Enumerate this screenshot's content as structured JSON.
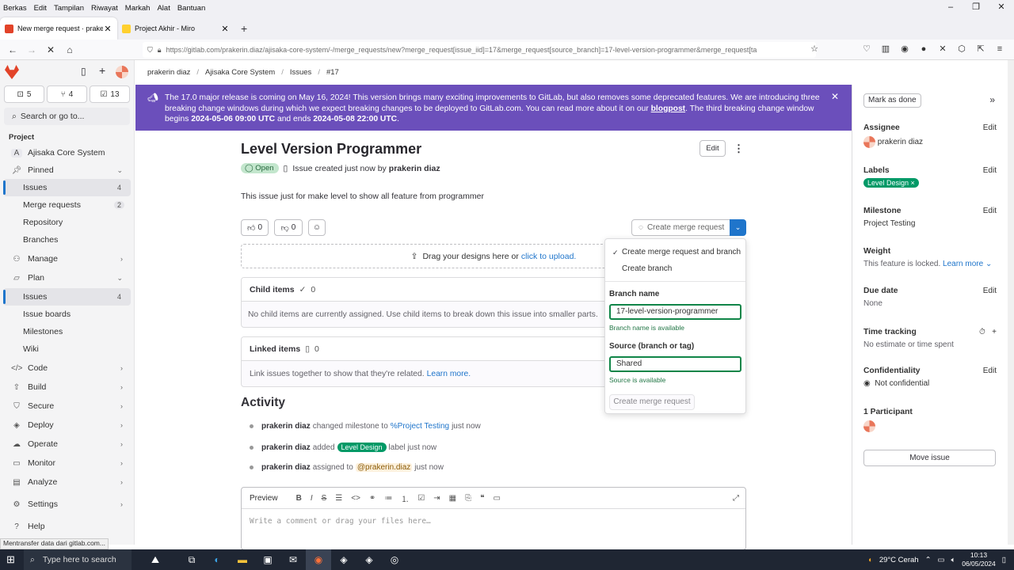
{
  "browser": {
    "menu": [
      "Berkas",
      "Edit",
      "Tampilan",
      "Riwayat",
      "Markah",
      "Alat",
      "Bantuan"
    ],
    "tabs": [
      {
        "title": "New merge request · prakerin d",
        "color": "#e24329"
      },
      {
        "title": "Project Akhir - Miro",
        "color": "#ffd02f"
      }
    ],
    "url": "https://gitlab.com/prakerin.diaz/ajisaka-core-system/-/merge_requests/new?merge_request[issue_iid]=17&merge_request[source_branch]=17-level-version-programmer&merge_request[ta",
    "status_text": "Mentransfer data dari gitlab.com..."
  },
  "sidebar": {
    "counts": {
      "issues": "5",
      "mrs": "4",
      "todos": "13"
    },
    "search": "Search or go to...",
    "section": "Project",
    "project": {
      "initial": "A",
      "name": "Ajisaka Core System"
    },
    "items": [
      {
        "label": "Pinned"
      },
      {
        "label": "Issues",
        "badge": "4"
      },
      {
        "label": "Merge requests",
        "badge": "2"
      },
      {
        "label": "Repository"
      },
      {
        "label": "Branches"
      },
      {
        "label": "Manage"
      },
      {
        "label": "Plan"
      },
      {
        "label": "Issues",
        "badge": "4"
      },
      {
        "label": "Issue boards"
      },
      {
        "label": "Milestones"
      },
      {
        "label": "Wiki"
      },
      {
        "label": "Code"
      },
      {
        "label": "Build"
      },
      {
        "label": "Secure"
      },
      {
        "label": "Deploy"
      },
      {
        "label": "Operate"
      },
      {
        "label": "Monitor"
      },
      {
        "label": "Analyze"
      },
      {
        "label": "Settings"
      },
      {
        "label": "Help"
      }
    ]
  },
  "breadcrumb": [
    "prakerin diaz",
    "Ajisaka Core System",
    "Issues",
    "#17"
  ],
  "banner": {
    "text1": "The 17.0 major release is coming on May 16, 2024! This version brings many exciting improvements to GitLab, but also removes some deprecated features. We are introducing three breaking change windows during which we expect breaking changes to be deployed to GitLab.com. You can read more about it on our ",
    "link": "blogpost",
    "text2": ". The third breaking change window begins ",
    "start": "2024-05-06 09:00 UTC",
    "text3": " and ends ",
    "end": "2024-05-08 22:00 UTC",
    "text4": "."
  },
  "issue": {
    "title": "Level Version Programmer",
    "edit": "Edit",
    "status": "Open",
    "created": "Issue created just now by",
    "author": "prakerin diaz",
    "description": "This issue just for make level to show all feature from programmer",
    "thumbs_up": "0",
    "thumbs_down": "0",
    "create_mr": "Create merge request",
    "dropzone_text": "Drag your designs here or",
    "dropzone_link": "click to upload.",
    "child_items": {
      "title": "Child items",
      "count": "0",
      "body": "No child items are currently assigned. Use child items to break down this issue into smaller parts."
    },
    "linked_items": {
      "title": "Linked items",
      "count": "0",
      "body": "Link issues together to show that they're related.",
      "link": "Learn more."
    }
  },
  "activity": {
    "title": "Activity",
    "items": [
      {
        "user": "prakerin diaz",
        "pre": "changed milestone to",
        "target": "%Project Testing",
        "post": "just now"
      },
      {
        "user": "prakerin diaz",
        "pre": "added",
        "target": "Level Design",
        "post": "label just now"
      },
      {
        "user": "prakerin diaz",
        "pre": "assigned to",
        "target": "@prakerin.diaz",
        "post": "just now"
      }
    ]
  },
  "editor": {
    "preview": "Preview",
    "placeholder": "Write a comment or drag your files here…"
  },
  "dropdown": {
    "opt1": "Create merge request and branch",
    "opt2": "Create branch",
    "branch_label": "Branch name",
    "branch_value": "17-level-version-programmer",
    "branch_ok": "Branch name is available",
    "source_label": "Source (branch or tag)",
    "source_value": "Shared",
    "source_ok": "Source is available",
    "submit": "Create merge request"
  },
  "right": {
    "mark_done": "Mark as done",
    "assignee": {
      "title": "Assignee",
      "edit": "Edit",
      "value": "prakerin diaz"
    },
    "labels": {
      "title": "Labels",
      "edit": "Edit",
      "value": "Level Design"
    },
    "milestone": {
      "title": "Milestone",
      "edit": "Edit",
      "value": "Project Testing"
    },
    "weight": {
      "title": "Weight",
      "value": "This feature is locked.",
      "link": "Learn more"
    },
    "due": {
      "title": "Due date",
      "edit": "Edit",
      "value": "None"
    },
    "time": {
      "title": "Time tracking",
      "value": "No estimate or time spent"
    },
    "conf": {
      "title": "Confidentiality",
      "edit": "Edit",
      "value": "Not confidential"
    },
    "participants": {
      "title": "1 Participant"
    },
    "move": "Move issue"
  },
  "taskbar": {
    "search": "Type here to search",
    "weather": "29°C Cerah",
    "time": "10:13",
    "date": "06/05/2024"
  },
  "colors": {
    "accent": "#1f75cb",
    "banner": "#6b4fbb",
    "success": "#108548",
    "label": "#009966"
  }
}
